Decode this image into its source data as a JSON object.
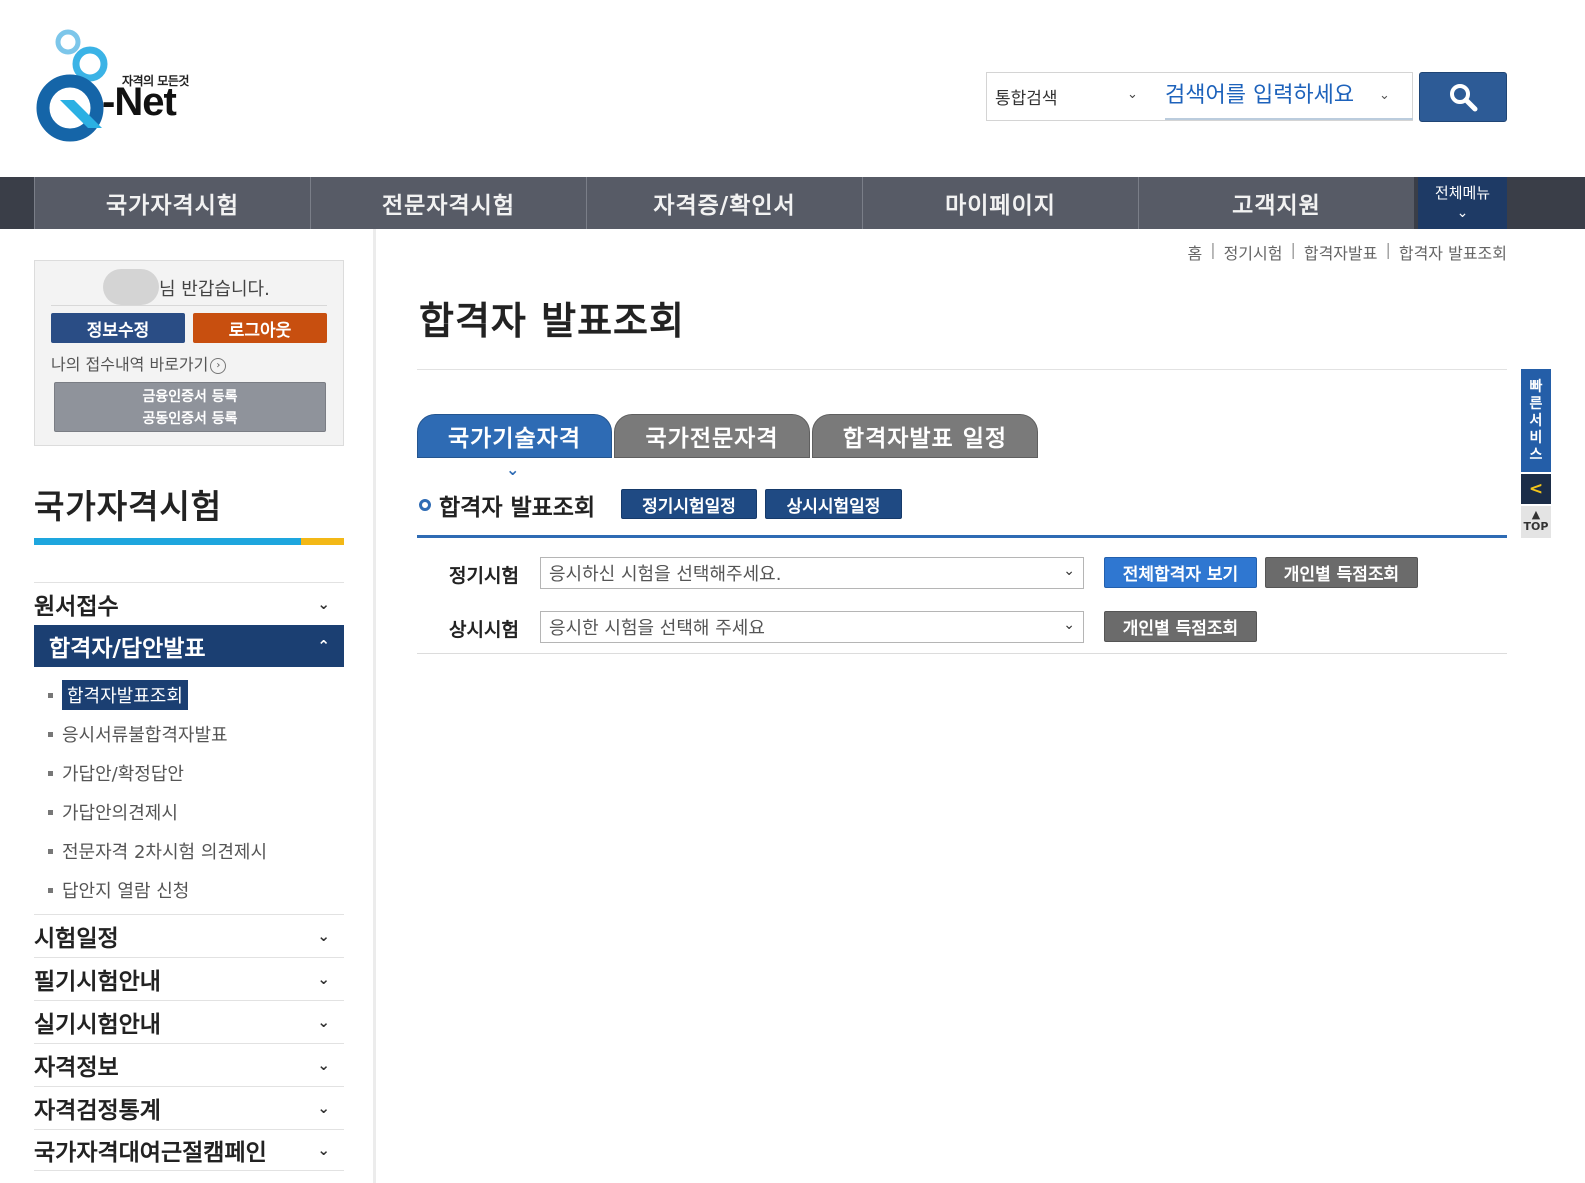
{
  "header": {
    "logo_slogan": "자격의 모든것",
    "logo_brand": "-Net",
    "search_type": "통합검색",
    "search_placeholder": "검색어를 입력하세요"
  },
  "gnb": {
    "items": [
      "국가자격시험",
      "전문자격시험",
      "자격증/확인서",
      "마이페이지",
      "고객지원"
    ],
    "all_menu": "전체메뉴"
  },
  "login": {
    "welcome": "님 반갑습니다.",
    "edit_label": "정보수정",
    "logout_label": "로그아웃",
    "my_link": "나의 접수내역 바로가기",
    "cert_line1": "금융인증서 등록",
    "cert_line2": "공동인증서 등록"
  },
  "sidebar": {
    "title": "국가자격시험",
    "menu": [
      {
        "label": "원서접수",
        "arrow": "⌄"
      },
      {
        "label": "합격자/답안발표",
        "arrow": "⌃"
      },
      {
        "label": "시험일정",
        "arrow": "⌄"
      },
      {
        "label": "필기시험안내",
        "arrow": "⌄"
      },
      {
        "label": "실기시험안내",
        "arrow": "⌄"
      },
      {
        "label": "자격정보",
        "arrow": "⌄"
      },
      {
        "label": "자격검정통계",
        "arrow": "⌄"
      },
      {
        "label": "국가자격대여근절캠페인",
        "arrow": "⌄"
      }
    ],
    "sub_items": [
      "합격자발표조회",
      "응시서류불합격자발표",
      "가답안/확정답안",
      "가답안의견제시",
      "전문자격 2차시험 의견제시",
      "답안지 열람 신청"
    ]
  },
  "breadcrumb": [
    "홈",
    "정기시험",
    "합격자발표",
    "합격자 발표조회"
  ],
  "main": {
    "title": "합격자 발표조회",
    "tabs": [
      "국가기술자격",
      "국가전문자격",
      "합격자발표 일정"
    ],
    "sub_title": "합격자 발표조회",
    "schedule_buttons": [
      "정기시험일정",
      "상시시험일정"
    ],
    "rows": [
      {
        "label": "정기시험",
        "select": "응시하신 시험을 선택해주세요.",
        "btn1": "전체합격자 보기",
        "btn2": "개인별 득점조회"
      },
      {
        "label": "상시시험",
        "select": "응시한 시험을 선택해 주세요",
        "btn1": "개인별 득점조회"
      }
    ]
  },
  "quick": {
    "label_chars": [
      "빠",
      "른",
      "서",
      "비",
      "스"
    ],
    "arrow": "<",
    "top": "TOP"
  },
  "colors": {
    "brand_blue": "#1b3f72",
    "accent_blue": "#2e6bb4",
    "logout_orange": "#c84f0f",
    "gnb_gray": "#575b66"
  }
}
